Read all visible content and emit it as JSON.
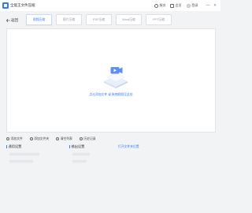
{
  "app": {
    "title": "全能王文件压缩"
  },
  "titlebar": {
    "service_label": "服务",
    "vip_label": "会员",
    "account_label": "登录",
    "minimize": "—",
    "close": "✕"
  },
  "nav": {
    "back_label": "返回",
    "tabs": [
      {
        "label": "视频压缩",
        "active": true
      },
      {
        "label": "图片压缩",
        "active": false
      },
      {
        "label": "PDF压缩",
        "active": false
      },
      {
        "label": "Word压缩",
        "active": false
      },
      {
        "label": "PPT压缩",
        "active": false
      }
    ]
  },
  "dropzone": {
    "text": "点击添加文件 或 拖拽视频至此处"
  },
  "actions": [
    {
      "label": "添加文件",
      "icon": "plus-circle-icon"
    },
    {
      "label": "添加文件夹",
      "icon": "plus-circle-icon"
    },
    {
      "label": "清空列表",
      "icon": "clear-circle-icon"
    },
    {
      "label": "历史记录",
      "icon": "clock-icon"
    }
  ],
  "settings": {
    "common_title": "通用设置",
    "output_title": "输出设置",
    "open_folder_label": "打开文件夹位置"
  },
  "colors": {
    "accent": "#2f7cf6",
    "background": "#f2f3f5"
  }
}
